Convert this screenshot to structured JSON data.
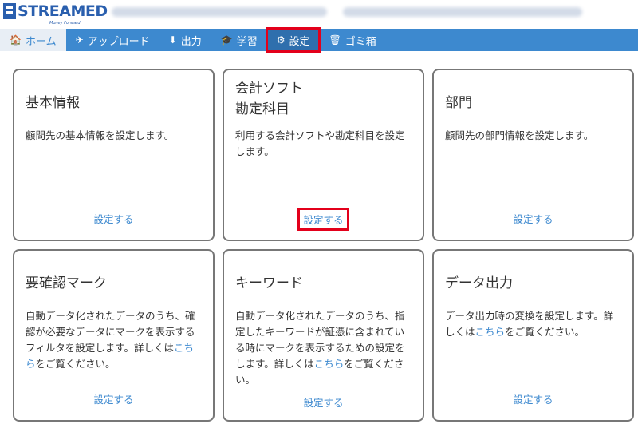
{
  "brand": {
    "logo_text": "STREAMED",
    "logo_sub": "Money Forward"
  },
  "nav": {
    "items": [
      {
        "icon": "home-icon",
        "glyph": "🏠",
        "label": "ホーム"
      },
      {
        "icon": "upload-icon",
        "glyph": "✈",
        "label": "アップロード"
      },
      {
        "icon": "export-icon",
        "glyph": "⬇",
        "label": "出力"
      },
      {
        "icon": "graduation-cap-icon",
        "glyph": "🎓",
        "label": "学習"
      },
      {
        "icon": "gear-icon",
        "glyph": "⚙",
        "label": "設定"
      },
      {
        "icon": "trash-icon",
        "glyph": "🗑",
        "label": "ゴミ箱"
      }
    ]
  },
  "cards": [
    {
      "title": "基本情報",
      "desc": "顧問先の基本情報を設定します。",
      "link": "設定する"
    },
    {
      "title": "会計ソフト\n勘定科目",
      "desc": "利用する会計ソフトや勘定科目を設定します。",
      "link": "設定する"
    },
    {
      "title": "部門",
      "desc": "顧問先の部門情報を設定します。",
      "link": "設定する"
    },
    {
      "title": "要確認マーク",
      "desc_pre": "自動データ化されたデータのうち、確認が必要なデータにマークを表示するフィルタを設定します。詳しくは",
      "desc_link": "こちら",
      "desc_post": "をご覧ください。",
      "link": "設定する"
    },
    {
      "title": "キーワード",
      "desc_pre": "自動データ化されたデータのうち、指定したキーワードが証憑に含まれている時にマークを表示するための設定をします。詳しくは",
      "desc_link": "こちら",
      "desc_post": "をご覧ください。",
      "link": "設定する"
    },
    {
      "title": "データ出力",
      "desc_pre": "データ出力時の変換を設定します。詳しくは",
      "desc_link": "こちら",
      "desc_post": "をご覧ください。",
      "link": "設定する"
    }
  ],
  "colors": {
    "nav_bg": "#3d89cf",
    "brand": "#2a5fae",
    "link": "#3d89cf",
    "highlight": "#e3001b"
  }
}
